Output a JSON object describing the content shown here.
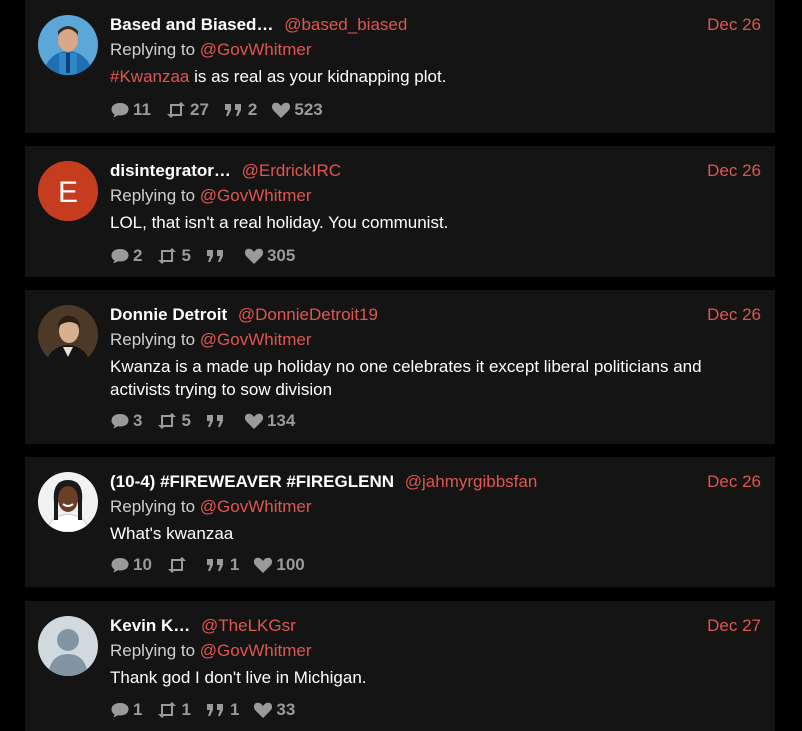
{
  "colors": {
    "accent": "#e0564f",
    "card": "#141414",
    "background": "#000000",
    "muted": "#9a9a9a"
  },
  "tweets": [
    {
      "name": "Based and Biased…",
      "handle": "@based_biased",
      "date": "Dec 26",
      "reply_prefix": "Replying to",
      "reply_to": "@GovWhitmer",
      "hashtag": "#Kwanzaa",
      "text": " is as real as your kidnapping plot.",
      "replies": "11",
      "retweets": "27",
      "quotes": "2",
      "likes": "523",
      "avatar": "photo-man-blue-shirt"
    },
    {
      "name": "disintegrator…",
      "handle": "@ErdrickIRC",
      "date": "Dec 26",
      "reply_prefix": "Replying to",
      "reply_to": "@GovWhitmer",
      "text": "LOL, that isn't a real holiday. You communist.",
      "replies": "2",
      "retweets": "5",
      "quotes": "",
      "likes": "305",
      "avatar": "letter-E",
      "avatar_letter": "E"
    },
    {
      "name": "Donnie Detroit",
      "handle": "@DonnieDetroit19",
      "date": "Dec 26",
      "reply_prefix": "Replying to",
      "reply_to": "@GovWhitmer",
      "text_line1": "Kwanza is a made up holiday no one celebrates it except liberal politicians and",
      "text_line2": "activists trying to sow division",
      "replies": "3",
      "retweets": "5",
      "quotes": "",
      "likes": "134",
      "avatar": "portrait-painting"
    },
    {
      "name": "(10-4) #FIREWEAVER #FIREGLENN",
      "handle": "@jahmyrgibbsfan",
      "date": "Dec 26",
      "reply_prefix": "Replying to",
      "reply_to": "@GovWhitmer",
      "text": "What's kwanzaa",
      "replies": "10",
      "retweets": "",
      "quotes": "1",
      "likes": "100",
      "avatar": "photo-player"
    },
    {
      "name": "Kevin K…",
      "handle": "@TheLKGsr",
      "date": "Dec 27",
      "reply_prefix": "Replying to",
      "reply_to": "@GovWhitmer",
      "text": "Thank god I don't live in Michigan.",
      "replies": "1",
      "retweets": "1",
      "quotes": "1",
      "likes": "33",
      "avatar": "default-profile"
    }
  ]
}
